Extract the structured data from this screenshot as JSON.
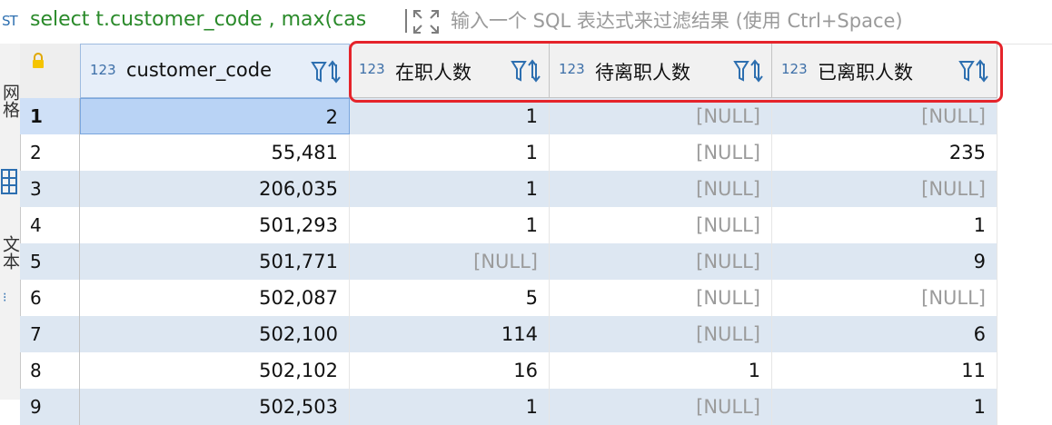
{
  "filter_bar": {
    "sql_icon": "sql-icon",
    "sql_text": "select t.customer_code , max(cas",
    "placeholder": "输入一个 SQL 表达式来过滤结果 (使用 Ctrl+Space)"
  },
  "side_tabs": {
    "grid_label": "网格",
    "text_label": "文本"
  },
  "columns": [
    {
      "type": "123",
      "label": "customer_code"
    },
    {
      "type": "123",
      "label": "在职人数"
    },
    {
      "type": "123",
      "label": "待离职人数"
    },
    {
      "type": "123",
      "label": "已离职人数"
    }
  ],
  "rows": [
    {
      "num": "1",
      "cells": [
        "2",
        "1",
        "[NULL]",
        "[NULL]"
      ]
    },
    {
      "num": "2",
      "cells": [
        "55,481",
        "1",
        "[NULL]",
        "235"
      ]
    },
    {
      "num": "3",
      "cells": [
        "206,035",
        "1",
        "[NULL]",
        "[NULL]"
      ]
    },
    {
      "num": "4",
      "cells": [
        "501,293",
        "1",
        "[NULL]",
        "1"
      ]
    },
    {
      "num": "5",
      "cells": [
        "501,771",
        "[NULL]",
        "[NULL]",
        "9"
      ]
    },
    {
      "num": "6",
      "cells": [
        "502,087",
        "5",
        "[NULL]",
        "[NULL]"
      ]
    },
    {
      "num": "7",
      "cells": [
        "502,100",
        "114",
        "[NULL]",
        "6"
      ]
    },
    {
      "num": "8",
      "cells": [
        "502,102",
        "16",
        "1",
        "11"
      ]
    },
    {
      "num": "9",
      "cells": [
        "502,503",
        "1",
        "[NULL]",
        "1"
      ]
    }
  ],
  "colors": {
    "highlight": "#e5242b",
    "sql_text": "#2a8a2a",
    "null_text": "#9b9b9b",
    "row_alt": "#dde7f2"
  }
}
